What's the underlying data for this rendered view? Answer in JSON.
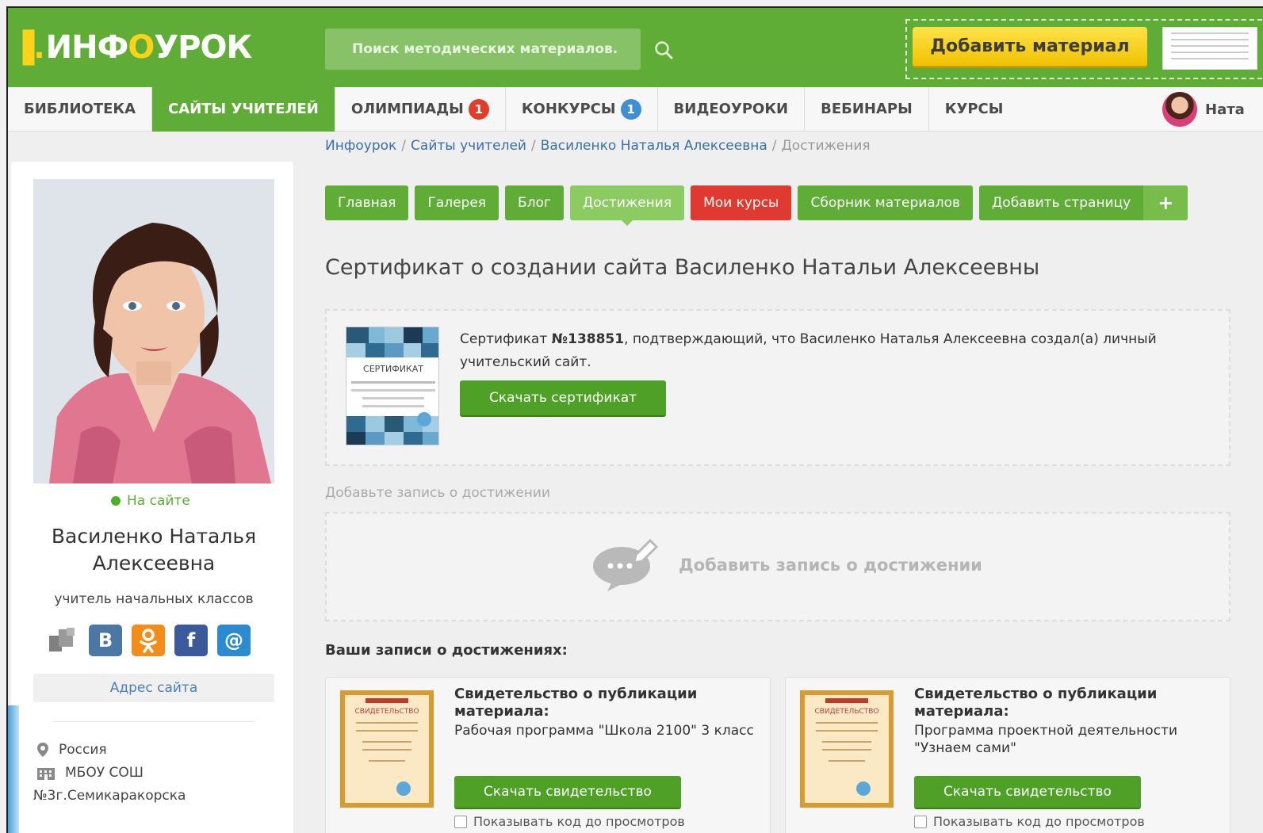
{
  "header": {
    "logo_mark": "▐.",
    "logo_text_1": "ИНФ",
    "logo_text_o": "О",
    "logo_text_2": "УРОК",
    "search_placeholder": "Поиск методических материалов.",
    "add_material_label": "Добавить материал"
  },
  "nav": {
    "items": [
      {
        "label": "БИБЛИОТЕКА"
      },
      {
        "label": "САЙТЫ УЧИТЕЛЕЙ",
        "active": true
      },
      {
        "label": "ОЛИМПИАДЫ",
        "badge": "1"
      },
      {
        "label": "КОНКУРСЫ",
        "badge": "1"
      },
      {
        "label": "ВИДЕОУРОКИ"
      },
      {
        "label": "ВЕБИНАРЫ"
      },
      {
        "label": "КУРСЫ"
      }
    ],
    "user_name": "Ната"
  },
  "sidebar": {
    "status": "На сайте",
    "name": "Василенко Наталья Алексеевна",
    "role": "учитель начальных классов",
    "site_address": "Адрес сайта",
    "country": "Россия",
    "school_line1": "МБОУ СОШ",
    "school_line2": "№3г.Семикаракорска",
    "social": [
      "copy-icon",
      "vk-icon",
      "ok-icon",
      "facebook-icon",
      "mail-icon"
    ]
  },
  "breadcrumb": {
    "items": [
      "Инфоурок",
      "Сайты учителей",
      "Василенко Наталья Алексеевна"
    ],
    "current": "Достижения",
    "separator": "/"
  },
  "tabs": {
    "home": "Главная",
    "gallery": "Галерея",
    "blog": "Блог",
    "achievements": "Достижения",
    "my_courses": "Мои курсы",
    "collection": "Сборник материалов",
    "add_page": "Добавить страницу",
    "add_page_plus": "+"
  },
  "main": {
    "title": "Сертификат о создании сайта Василенко Натальи Алексеевны",
    "certificate": {
      "text_before": "Сертификат ",
      "number": "№138851",
      "text_after": ", подтверждающий, что Василенко Наталья Алексеевна создал(а) личный учительский сайт.",
      "thumb_label": "СЕРТИФИКАТ",
      "download_label": "Скачать сертификат"
    },
    "add_hint": "Добавьте запись о достижении",
    "add_entry_label": "Добавить запись о достижении",
    "records_title": "Ваши записи о достижениях:",
    "records": [
      {
        "title": "Свидетельство о публикации материала:",
        "subtitle": "Рабочая программа \"Школа 2100\" 3 класс",
        "thumb_label": "СВИДЕТЕЛЬСТВО",
        "download_label": "Скачать свидетельство",
        "checkbox_label": "Показывать код до просмотров"
      },
      {
        "title": "Свидетельство о публикации материала:",
        "subtitle": "Программа проектной деятельности \"Узнаем сами\"",
        "thumb_label": "СВИДЕТЕЛЬСТВО",
        "download_label": "Скачать свидетельство",
        "checkbox_label": "Показывать код до просмотров"
      }
    ]
  },
  "colors": {
    "brand_green": "#5fac36",
    "accent_yellow": "#ffd21a",
    "red_tab": "#e0392f",
    "link_blue": "#3a6fa7"
  }
}
